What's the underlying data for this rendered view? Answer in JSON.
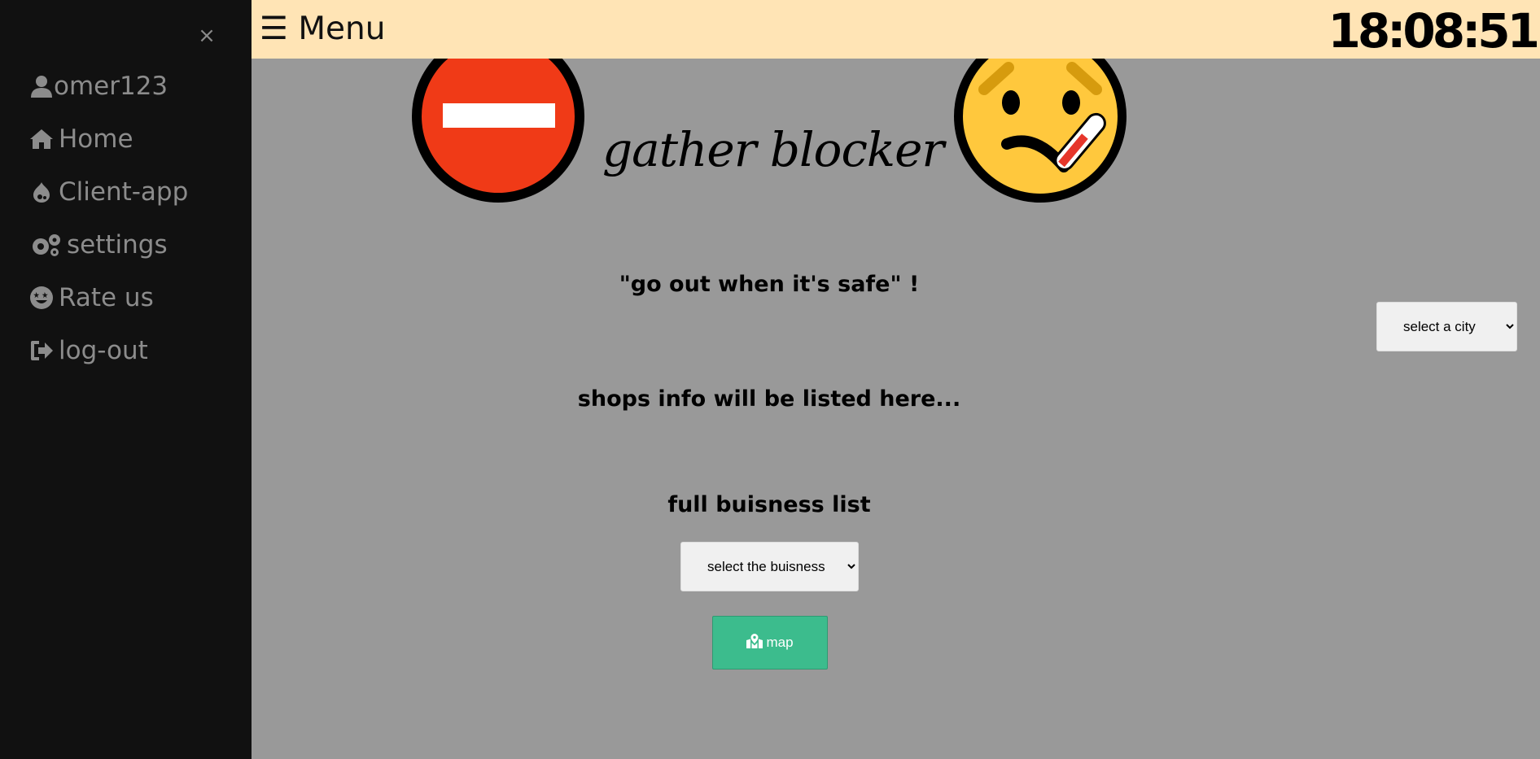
{
  "sidebar": {
    "close_label": "×",
    "items": [
      {
        "label": "omer123",
        "icon": "user-icon"
      },
      {
        "label": "Home",
        "icon": "home-icon"
      },
      {
        "label": "Client-app",
        "icon": "drupal-icon"
      },
      {
        "label": "settings",
        "icon": "gears-icon"
      },
      {
        "label": "Rate us",
        "icon": "grin-stars-icon"
      },
      {
        "label": "log-out",
        "icon": "sign-out-icon"
      }
    ]
  },
  "topbar": {
    "menu_label": "☰ Menu",
    "clock": "18:08:51"
  },
  "main": {
    "title": "gather blocker",
    "slogan": "\"go out when it's safe\" !",
    "shops_info": "shops info will be listed here...",
    "full_list_heading": "full buisness list",
    "business_select": {
      "selected": "select the buisness"
    },
    "city_select": {
      "selected": "select a city"
    },
    "map_button_label": "map"
  },
  "colors": {
    "sidebar_bg": "#111111",
    "topbar_bg": "#ffe4b5",
    "main_bg": "#999999",
    "map_button": "#3cbc8d",
    "stop_sign_red": "#f03a17",
    "face_yellow": "#ffc83d"
  }
}
